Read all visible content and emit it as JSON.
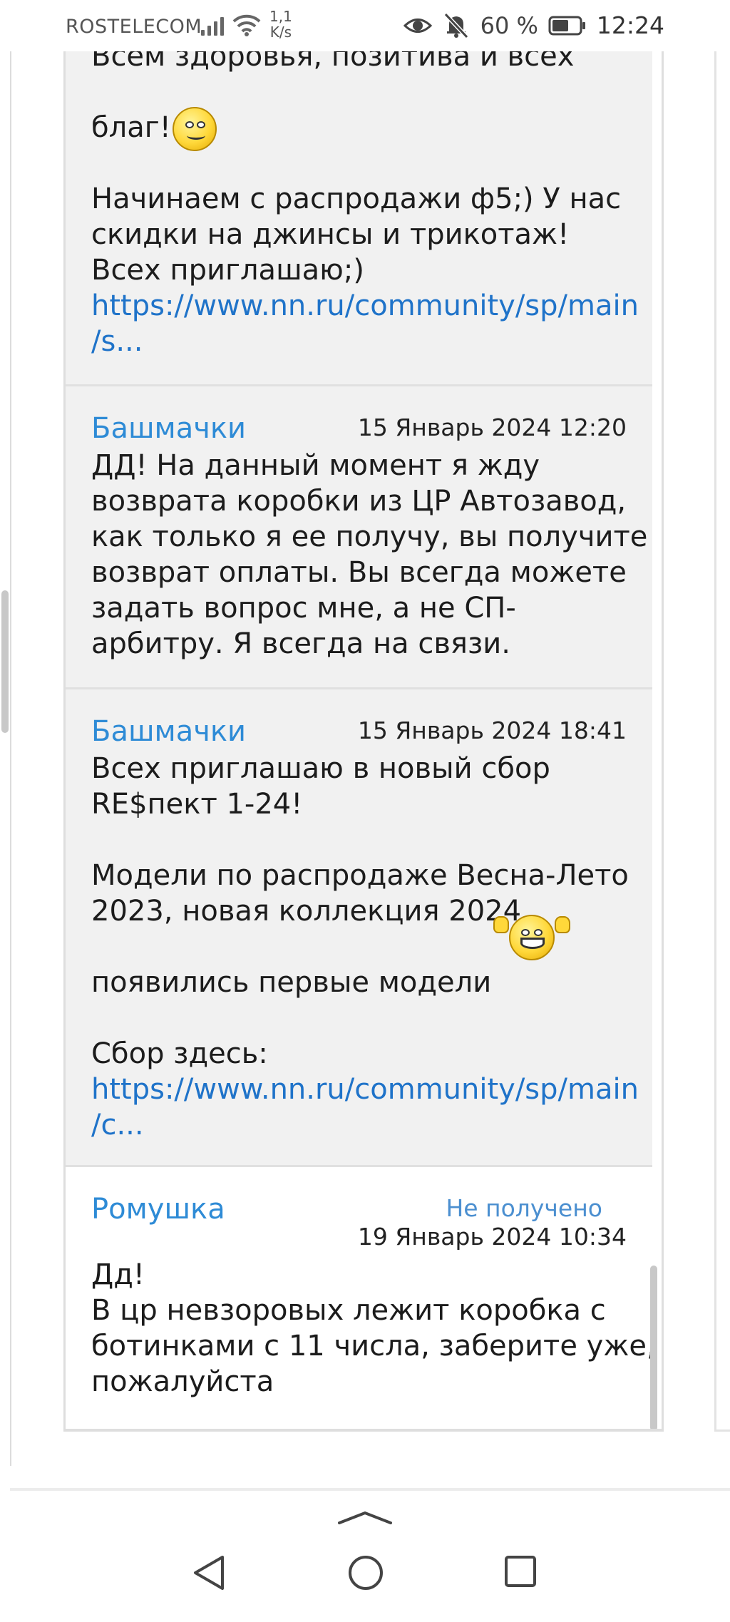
{
  "status_bar": {
    "carrier": "ROSTELECOM",
    "net_speed_value": "1,1",
    "net_speed_unit": "K/s",
    "battery_percent": "60 %",
    "time": "12:24"
  },
  "messages": [
    {
      "lines_before_smiley": [
        "Всем здоровья, позитива и всех"
      ],
      "line_with_smiley": "благ!",
      "lines": [
        "Начинаем с распродажи ф5;) У нас",
        "скидки на джинсы и трикотаж!",
        "Всех приглашаю;)"
      ],
      "link_lines": [
        "https://www.nn.ru/community/sp/main",
        "/s..."
      ]
    },
    {
      "author": "Башмачки",
      "date": "15 Январь 2024 12:20",
      "lines": [
        "ДД! На данный момент я жду",
        "возврата коробки из ЦР Автозавод,",
        "как только я ее получу, вы получите",
        "возврат оплаты. Вы всегда можете",
        "задать вопрос мне, а не СП-",
        "арбитру. Я всегда на связи."
      ]
    },
    {
      "author": "Башмачки",
      "date": "15 Январь 2024 18:41",
      "lines_a": [
        "Всех приглашаю в новый сбор",
        "RE$пект 1-24!"
      ],
      "lines_b": [
        "Модели по распродаже Весна-Лето",
        "2023, новая коллекция 2024,"
      ],
      "line_with_smiley": "появились первые модели",
      "lines_c": [
        "Сбор здесь:"
      ],
      "link_lines": [
        "https://www.nn.ru/community/sp/main",
        "/c..."
      ]
    },
    {
      "author": "Ромушка",
      "status": "Не получено",
      "date": "19 Январь 2024 10:34",
      "lines": [
        "Дд!",
        "В цр невзоровых лежит коробка с",
        "ботинками с 11 числа, заберите уже,",
        "пожалуйста"
      ]
    }
  ],
  "colors": {
    "author": "#2e8bd6",
    "link": "#1f73c9",
    "status": "#4b8fd0",
    "message_bg": "#f1f1f1"
  },
  "icons": {
    "smiley": "smiley-icon",
    "cheering_smiley": "cheering-smiley-icon",
    "nav_back": "back-triangle-icon",
    "nav_home": "home-circle-icon",
    "nav_recent": "recent-square-icon"
  }
}
